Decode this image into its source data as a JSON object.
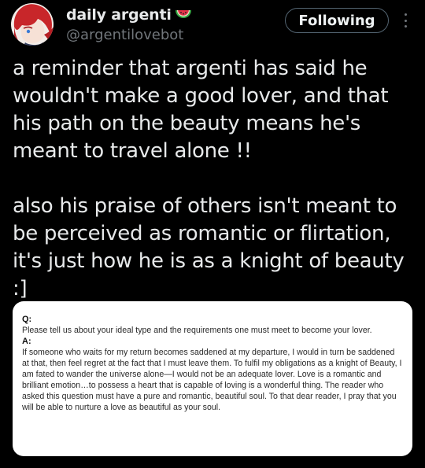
{
  "author": {
    "display_name": "daily argenti",
    "handle": "@argentilovebot",
    "badge_icon": "watermelon-icon"
  },
  "follow_button": {
    "label": "Following"
  },
  "more_menu_icon": "more-options-icon",
  "tweet": {
    "paragraphs": [
      "a reminder that argenti has said he wouldn't make a good lover, and that his path on the beauty means he's meant to travel alone !!",
      "also his praise of others isn't meant to be perceived as romantic or flirtation, it's just how he is as a knight of beauty :]"
    ]
  },
  "attachment": {
    "q_label": "Q:",
    "question": "Please tell us about your ideal type and the requirements one must meet to become your lover.",
    "a_label": "A:",
    "answer": "If someone who waits for my return becomes saddened at my departure, I would in turn be saddened at that, then feel regret at the fact that I must leave them. To fulfil my obligations as a knight of Beauty, I am fated to wander the universe alone—I would not be an adequate lover. Love is a romantic and brilliant emotion…to possess a heart that is capable of loving is a wonderful thing. The reader who asked this question must have a pure and romantic, beautiful soul. To that dear reader, I pray that you will be able to nurture a love as beautiful as your soul."
  },
  "colors": {
    "background": "#000000",
    "text": "#e7e9ea",
    "secondary_text": "#71767b",
    "card_background": "#ffffff"
  }
}
